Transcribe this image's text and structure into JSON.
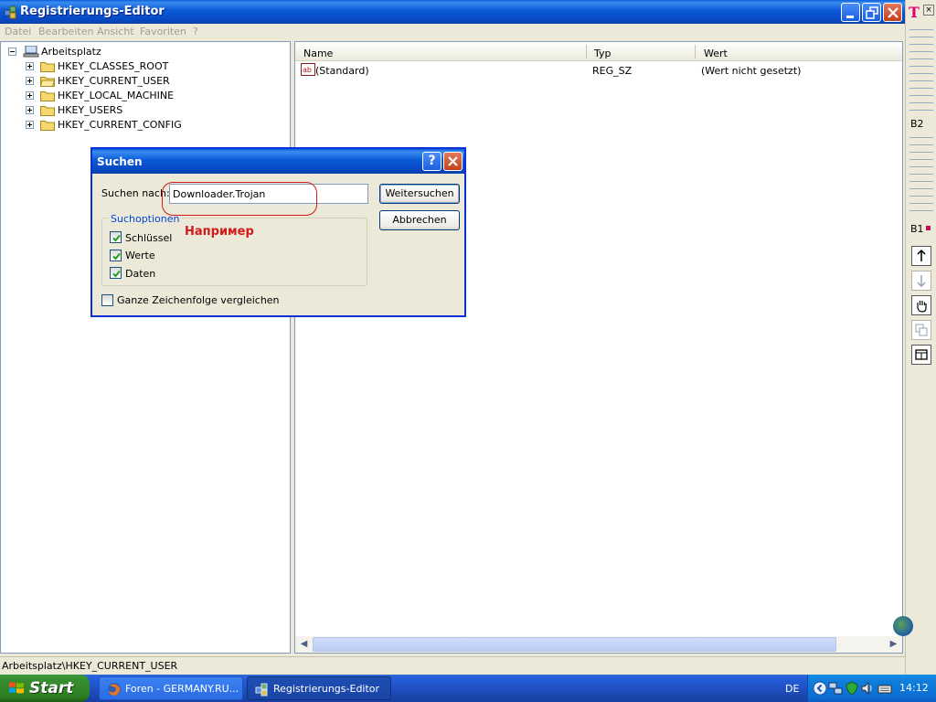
{
  "window": {
    "title": "Registrierungs-Editor",
    "menu": [
      "Datei",
      "Bearbeiten",
      "Ansicht",
      "Favoriten",
      "?"
    ]
  },
  "tree": {
    "root": "Arbeitsplatz",
    "items": [
      "HKEY_CLASSES_ROOT",
      "HKEY_CURRENT_USER",
      "HKEY_LOCAL_MACHINE",
      "HKEY_USERS",
      "HKEY_CURRENT_CONFIG"
    ]
  },
  "list": {
    "columns": [
      "Name",
      "Typ",
      "Wert"
    ],
    "rows": [
      {
        "name": "(Standard)",
        "type": "REG_SZ",
        "value": "(Wert nicht gesetzt)"
      }
    ]
  },
  "status": "Arbeitsplatz\\HKEY_CURRENT_USER",
  "dialog": {
    "title": "Suchen",
    "search_label": "Suchen nach:",
    "search_value": "Downloader.Trojan",
    "find_next": "Weitersuchen",
    "cancel": "Abbrechen",
    "options_group": "Suchoptionen",
    "options": [
      {
        "label": "Schlüssel",
        "checked": true
      },
      {
        "label": "Werte",
        "checked": true
      },
      {
        "label": "Daten",
        "checked": true
      }
    ],
    "whole_string": {
      "label": "Ganze Zeichenfolge vergleichen",
      "checked": false
    },
    "annotation": "Например"
  },
  "side_toolbar": {
    "brand": "T",
    "close": "×",
    "level_top": "B2",
    "level_bottom": "B1"
  },
  "taskbar": {
    "start": "Start",
    "tasks": [
      {
        "label": "Foren - GERMANY.RU...",
        "active": false
      },
      {
        "label": "Registrierungs-Editor",
        "active": true
      }
    ],
    "language": "DE",
    "clock": "14:12"
  },
  "colors": {
    "titlebar": "#0b59d6",
    "annotation": "#d21a1a",
    "taskbar": "#245edb",
    "start_button": "#388e2e"
  }
}
